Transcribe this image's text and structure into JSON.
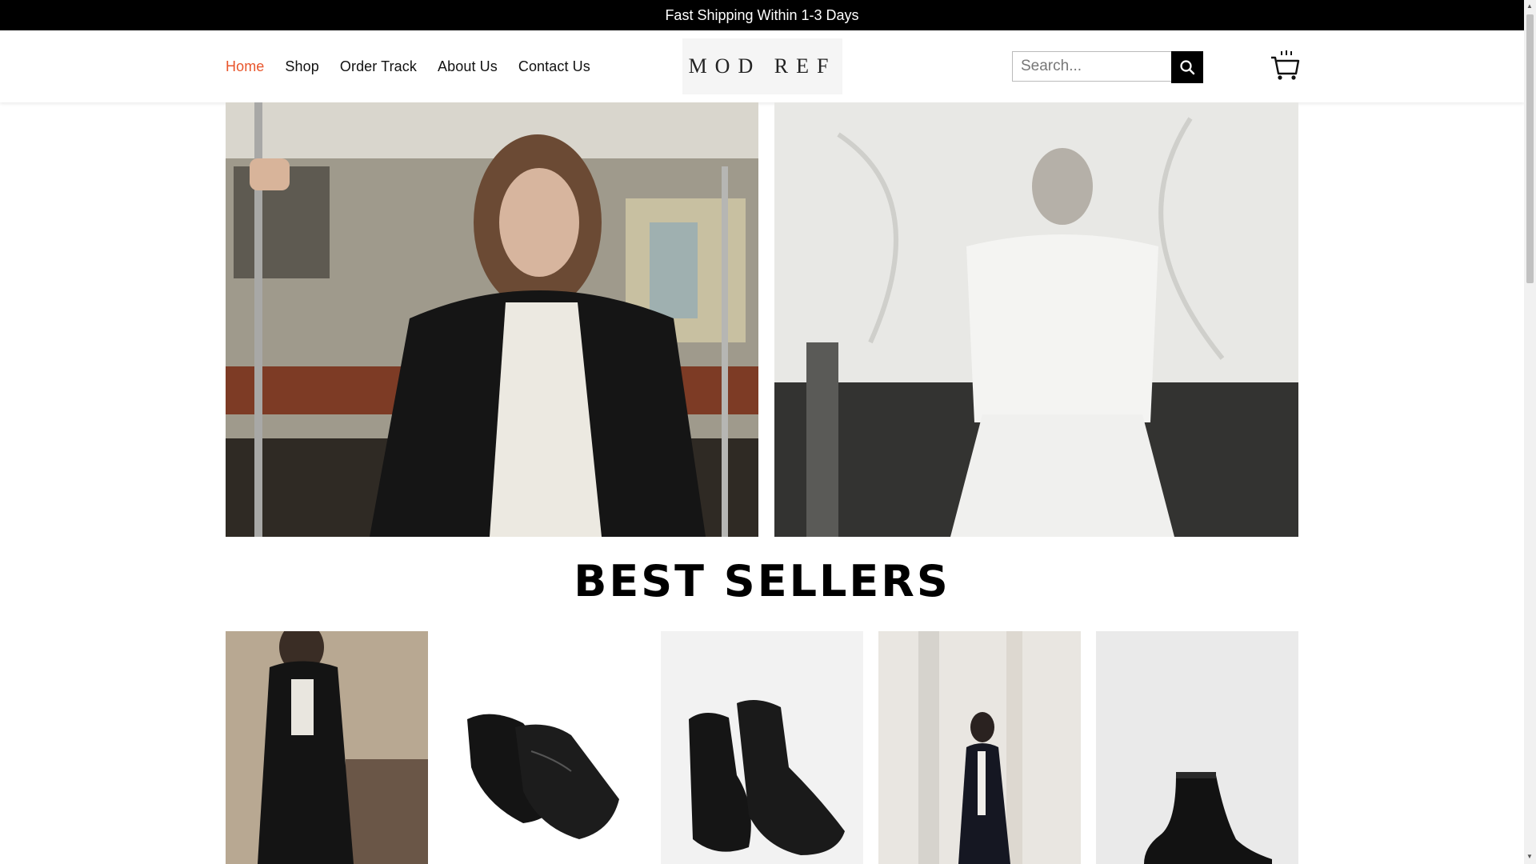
{
  "announcement": "Fast Shipping Within 1-3 Days",
  "nav": {
    "items": [
      {
        "label": "Home",
        "active": true
      },
      {
        "label": "Shop"
      },
      {
        "label": "Order Track"
      },
      {
        "label": "About Us"
      },
      {
        "label": "Contact Us"
      }
    ]
  },
  "brand": {
    "logo_text": "MOD REF"
  },
  "search": {
    "placeholder": "Search..."
  },
  "icons": {
    "search_button": "search-icon",
    "cart": "shopping-cart-icon"
  },
  "colors": {
    "accent": "#e8552b",
    "topbar": "#000000",
    "text": "#111111"
  },
  "hero": {
    "left_image": "woman in black coat holding pole on subway train",
    "right_image": "black and white photo of woman in white shirt and skirt in front of draped cloth"
  },
  "sections": {
    "best_sellers_title": "BEST SELLERS"
  },
  "products": [
    {
      "image": "long black coat on model"
    },
    {
      "image": "black leather derby shoes"
    },
    {
      "image": "black leather chelsea boots"
    },
    {
      "image": "long black coat on model in studio"
    },
    {
      "image": "black leather ankle boot"
    }
  ]
}
